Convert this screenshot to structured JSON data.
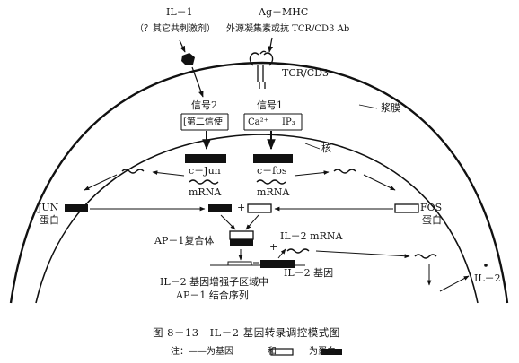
{
  "top": {
    "il1": "IL－1",
    "il1_sub": "（？其它共刺激剂）",
    "ag_mhc": "Ag＋MHC",
    "ag_sub": "外源凝集素或抗 TCR/CD3 Ab"
  },
  "membrane": {
    "receptor": "TCR/CD3",
    "plasma_membrane": "浆膜",
    "nucleus": "核"
  },
  "signals": {
    "signal2": "信号2",
    "second_messenger": "[第二信使",
    "signal1": "信号1",
    "ca": "Ca²⁺",
    "ip3": "IP₃"
  },
  "genes": {
    "cjun": "c－Jun",
    "cfos": "c－fos",
    "mrna_left": "mRNA",
    "mrna_right": "mRNA",
    "jun_protein": "JUN",
    "jun_protein_sub": "蛋白",
    "fos_protein": "FOS",
    "fos_protein_sub": "蛋白",
    "plus1": "+",
    "ap1_complex": "AP－1复合体",
    "plus2": "+",
    "il2_mrna": "IL－2 mRNA",
    "il2_gene": "IL－2 基因",
    "enhancer_line1": "IL－2 基因增强子区域中",
    "enhancer_line2": "AP－1 结合序列",
    "il2_out": "IL－2"
  },
  "caption": {
    "title": "图 8－13　IL－2 基因转录调控模式图",
    "note_prefix": "注：——为基因",
    "note_and": "和",
    "note_suffix": "为蛋白"
  }
}
